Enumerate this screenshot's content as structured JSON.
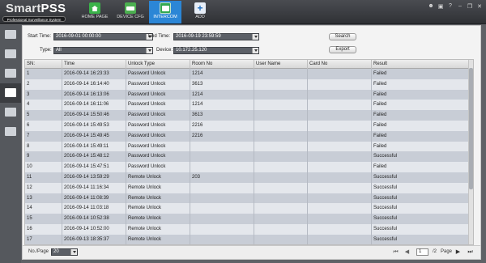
{
  "app": {
    "logo_title_a": "Smart",
    "logo_title_b": "PSS",
    "logo_subtitle": "Professional Surveillance System"
  },
  "nav": {
    "tabs": [
      {
        "label": "HOME PAGE",
        "icon": "home-icon"
      },
      {
        "label": "DEVICE CFG",
        "icon": "device-icon"
      },
      {
        "label": "INTERCOM",
        "icon": "intercom-icon",
        "active": true
      },
      {
        "label": "ADD",
        "icon": "add-icon"
      }
    ]
  },
  "window_controls": [
    "user-icon",
    "lock-icon",
    "help-icon",
    "minimize-icon",
    "restore-icon",
    "close-icon"
  ],
  "sidebar": {
    "items": [
      "camera-icon",
      "contacts-icon",
      "call-log-icon",
      "unlock-record-icon",
      "message-icon",
      "building-icon"
    ],
    "active_index": 3
  },
  "filters": {
    "start_time_label": "Start Time:",
    "start_time_value": "2016-09-01 00:00:00",
    "end_time_label": "End Time:",
    "end_time_value": "2016-09-19 23:59:59",
    "type_label": "Type:",
    "type_value": "All",
    "device_label": "Device:",
    "device_value": "10.172.25.120",
    "search_label": "Search",
    "export_label": "Export"
  },
  "table": {
    "columns": [
      "SN:",
      "Time",
      "Unlock Type",
      "Room No",
      "User Name",
      "Card No",
      "Result"
    ],
    "rows": [
      [
        "1",
        "2016-09-14 16:23:33",
        "Password Unlock",
        "1214",
        "",
        "",
        "Failed"
      ],
      [
        "2",
        "2016-09-14 16:14:40",
        "Password Unlock",
        "3613",
        "",
        "",
        "Failed"
      ],
      [
        "3",
        "2016-09-14 16:13:06",
        "Password Unlock",
        "1214",
        "",
        "",
        "Failed"
      ],
      [
        "4",
        "2016-09-14 16:11:06",
        "Password Unlock",
        "1214",
        "",
        "",
        "Failed"
      ],
      [
        "5",
        "2016-09-14 15:50:46",
        "Password Unlock",
        "3613",
        "",
        "",
        "Failed"
      ],
      [
        "6",
        "2016-09-14 15:49:53",
        "Password Unlock",
        "2216",
        "",
        "",
        "Failed"
      ],
      [
        "7",
        "2016-09-14 15:49:45",
        "Password Unlock",
        "2216",
        "",
        "",
        "Failed"
      ],
      [
        "8",
        "2016-09-14 15:49:11",
        "Password Unlock",
        "",
        "",
        "",
        "Failed"
      ],
      [
        "9",
        "2016-09-14 15:48:12",
        "Password Unlock",
        "",
        "",
        "",
        "Successful"
      ],
      [
        "10",
        "2016-09-14 15:47:51",
        "Password Unlock",
        "",
        "",
        "",
        "Failed"
      ],
      [
        "11",
        "2016-09-14 13:59:29",
        "Remote Unlock",
        "203",
        "",
        "",
        "Successful"
      ],
      [
        "12",
        "2016-09-14 11:16:34",
        "Remote Unlock",
        "",
        "",
        "",
        "Successful"
      ],
      [
        "13",
        "2016-09-14 11:08:39",
        "Remote Unlock",
        "",
        "",
        "",
        "Successful"
      ],
      [
        "14",
        "2016-09-14 11:03:18",
        "Remote Unlock",
        "",
        "",
        "",
        "Successful"
      ],
      [
        "15",
        "2016-09-14 10:52:38",
        "Remote Unlock",
        "",
        "",
        "",
        "Successful"
      ],
      [
        "16",
        "2016-09-14 10:52:00",
        "Remote Unlock",
        "",
        "",
        "",
        "Successful"
      ],
      [
        "17",
        "2016-09-13 18:35:37",
        "Remote Unlock",
        "",
        "",
        "",
        "Successful"
      ]
    ]
  },
  "footer": {
    "per_page_label": "No./Page",
    "per_page_value": "20",
    "current_page": "1",
    "total_pages": "/2",
    "page_label": "Page"
  }
}
